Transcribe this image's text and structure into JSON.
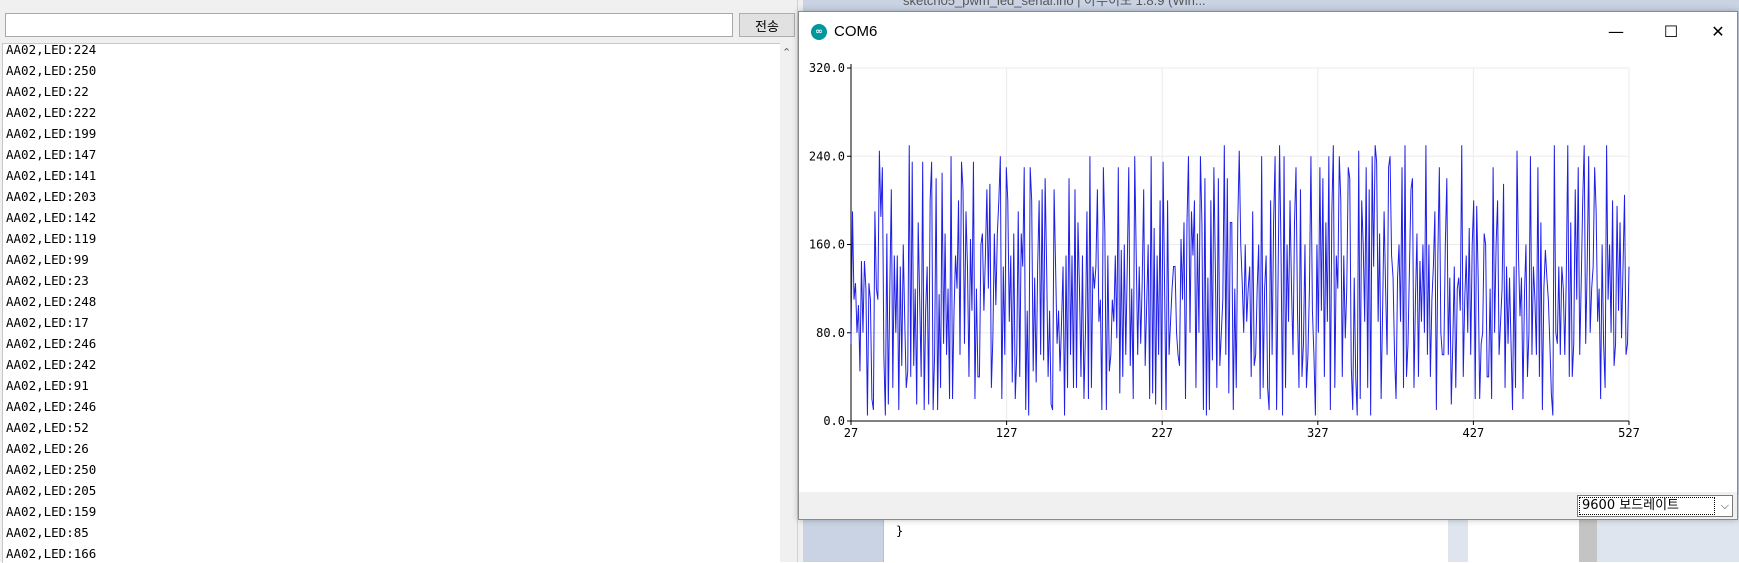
{
  "serial_monitor": {
    "send_input_value": "",
    "send_button_label": "전송",
    "lines": [
      "AA02,LED:224",
      "AA02,LED:250",
      "AA02,LED:22",
      "AA02,LED:222",
      "AA02,LED:199",
      "AA02,LED:147",
      "AA02,LED:141",
      "AA02,LED:203",
      "AA02,LED:142",
      "AA02,LED:119",
      "AA02,LED:99",
      "AA02,LED:23",
      "AA02,LED:248",
      "AA02,LED:17",
      "AA02,LED:246",
      "AA02,LED:242",
      "AA02,LED:91",
      "AA02,LED:246",
      "AA02,LED:52",
      "AA02,LED:26",
      "AA02,LED:250",
      "AA02,LED:205",
      "AA02,LED:159",
      "AA02,LED:85",
      "AA02,LED:166"
    ]
  },
  "background_editor": {
    "title": "sketch05_pwm_led_serial.ino | 아두이노 1.8.9 (Win...",
    "code_visible": "}"
  },
  "plotter": {
    "window_title": "COM6",
    "app_icon": "arduino-logo-icon",
    "controls": {
      "minimize": "—",
      "maximize": "☐",
      "close": "✕"
    },
    "baud_rate": "9600 보드레이트",
    "series_color": "#1f1fe6"
  },
  "chart_data": {
    "type": "line",
    "title": "",
    "xlabel": "",
    "ylabel": "",
    "xlim": [
      27,
      527
    ],
    "ylim": [
      0,
      320
    ],
    "x_ticks": [
      "27",
      "127",
      "227",
      "327",
      "427",
      "527"
    ],
    "y_ticks": [
      "0.0",
      "80.0",
      "160.0",
      "240.0",
      "320.0"
    ],
    "grid": true,
    "x_start": 27,
    "series": [
      {
        "values": [
          70,
          190,
          110,
          125,
          80,
          105,
          45,
          145,
          80,
          145,
          120,
          5,
          125,
          110,
          20,
          10,
          190,
          120,
          110,
          245,
          185,
          230,
          60,
          5,
          170,
          15,
          120,
          210,
          30,
          150,
          80,
          150,
          10,
          140,
          50,
          160,
          90,
          30,
          45,
          250,
          40,
          235,
          50,
          120,
          15,
          180,
          110,
          40,
          235,
          10,
          100,
          140,
          15,
          200,
          235,
          10,
          60,
          220,
          10,
          115,
          30,
          225,
          70,
          170,
          60,
          120,
          20,
          240,
          20,
          100,
          150,
          120,
          200,
          60,
          235,
          210,
          70,
          190,
          140,
          40,
          165,
          100,
          235,
          20,
          120,
          40,
          40,
          160,
          170,
          100,
          150,
          210,
          120,
          215,
          30,
          75,
          170,
          105,
          170,
          200,
          240,
          20,
          140,
          60,
          230,
          200,
          90,
          150,
          35,
          170,
          20,
          60,
          190,
          40,
          170,
          140,
          230,
          10,
          100,
          5,
          230,
          200,
          45,
          130,
          35,
          140,
          200,
          60,
          210,
          55,
          220,
          140,
          40,
          100,
          15,
          10,
          210,
          140,
          70,
          100,
          45,
          90,
          140,
          5,
          150,
          30,
          220,
          60,
          150,
          30,
          210,
          30,
          180,
          120,
          40,
          150,
          20,
          80,
          190,
          20,
          240,
          30,
          140,
          120,
          140,
          210,
          90,
          110,
          10,
          230,
          170,
          10,
          150,
          45,
          60,
          110,
          90,
          150,
          75,
          230,
          25,
          155,
          40,
          160,
          60,
          140,
          230,
          50,
          120,
          20,
          240,
          150,
          60,
          140,
          70,
          125,
          210,
          50,
          105,
          160,
          20,
          240,
          25,
          175,
          15,
          150,
          60,
          200,
          10,
          235,
          120,
          10,
          200,
          60,
          90,
          120,
          140,
          140,
          80,
          60,
          50,
          165,
          110,
          180,
          20,
          180,
          240,
          80,
          190,
          150,
          200,
          30,
          170,
          80,
          240,
          180,
          10,
          220,
          5,
          130,
          10,
          200,
          55,
          230,
          140,
          30,
          220,
          50,
          80,
          110,
          250,
          60,
          220,
          25,
          180,
          180,
          10,
          120,
          30,
          180,
          245,
          160,
          125,
          80,
          160,
          90,
          120,
          140,
          40,
          190,
          50,
          60,
          120,
          160,
          20,
          240,
          30,
          120,
          150,
          30,
          10,
          200,
          60,
          180,
          240,
          10,
          130,
          250,
          150,
          5,
          240,
          30,
          160,
          90,
          200,
          120,
          60,
          180,
          230,
          100,
          30,
          210,
          40,
          70,
          160,
          30,
          60,
          120,
          240,
          100,
          60,
          5,
          160,
          80,
          230,
          100,
          220,
          40,
          180,
          90,
          240,
          10,
          190,
          250,
          30,
          150,
          120,
          240,
          200,
          40,
          150,
          75,
          120,
          230,
          220,
          50,
          10,
          130,
          40,
          5,
          245,
          20,
          200,
          160,
          90,
          230,
          30,
          210,
          5,
          240,
          140,
          250,
          235,
          90,
          170,
          20,
          100,
          190,
          120,
          60,
          230,
          240,
          150,
          130,
          60,
          20,
          130,
          160,
          90,
          230,
          30,
          250,
          40,
          70,
          140,
          210,
          220,
          30,
          110,
          170,
          40,
          145,
          90,
          160,
          80,
          250,
          60,
          160,
          40,
          110,
          140,
          190,
          10,
          150,
          230,
          80,
          60,
          60,
          160,
          220,
          60,
          130,
          15,
          70,
          140,
          30,
          120,
          130,
          100,
          250,
          40,
          110,
          150,
          80,
          175,
          60,
          160,
          200,
          20,
          195,
          130,
          20,
          70,
          80,
          170,
          160,
          40,
          40,
          120,
          20,
          230,
          80,
          160,
          200,
          60,
          90,
          120,
          215,
          30,
          140,
          70,
          130,
          70,
          10,
          140,
          30,
          245,
          150,
          95,
          130,
          20,
          115,
          160,
          40,
          80,
          240,
          60,
          140,
          110,
          60,
          230,
          40,
          180,
          10,
          120,
          155,
          130,
          110,
          70,
          25,
          5,
          250,
          80,
          70,
          140,
          60,
          140,
          120,
          60,
          130,
          250,
          40,
          180,
          40,
          70,
          210,
          110,
          230,
          60,
          125,
          200,
          250,
          70,
          140,
          240,
          80,
          120,
          140,
          230,
          190,
          90,
          120,
          20,
          160,
          70,
          30,
          250,
          110,
          160,
          80,
          200,
          50,
          70,
          195,
          100,
          180,
          75,
          140,
          205,
          60,
          70,
          140
        ]
      }
    ]
  }
}
